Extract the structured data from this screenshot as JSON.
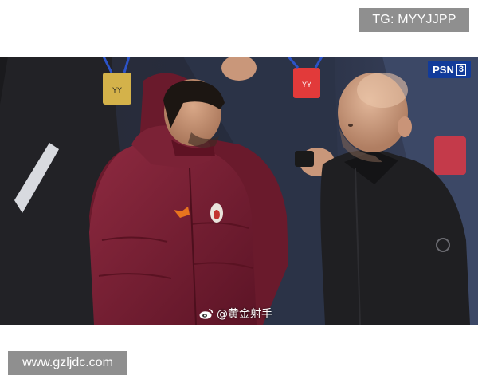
{
  "watermarks": {
    "top_right": "TG: MYYJJPP",
    "bottom_left": "www.gzljdc.com"
  },
  "photo": {
    "broadcaster_logo": "PSN",
    "broadcaster_logo_number": "3",
    "credit_icon": "weibo-icon",
    "credit_text": "@黄金射手",
    "badge_text_left": "YY",
    "badge_text_right": "YY"
  },
  "colors": {
    "jacket_maroon": "#7a1f33",
    "coat_black": "#1f1f22",
    "broadcaster_blue": "#123b9a",
    "watermark_gray": "#8f8f8f"
  }
}
